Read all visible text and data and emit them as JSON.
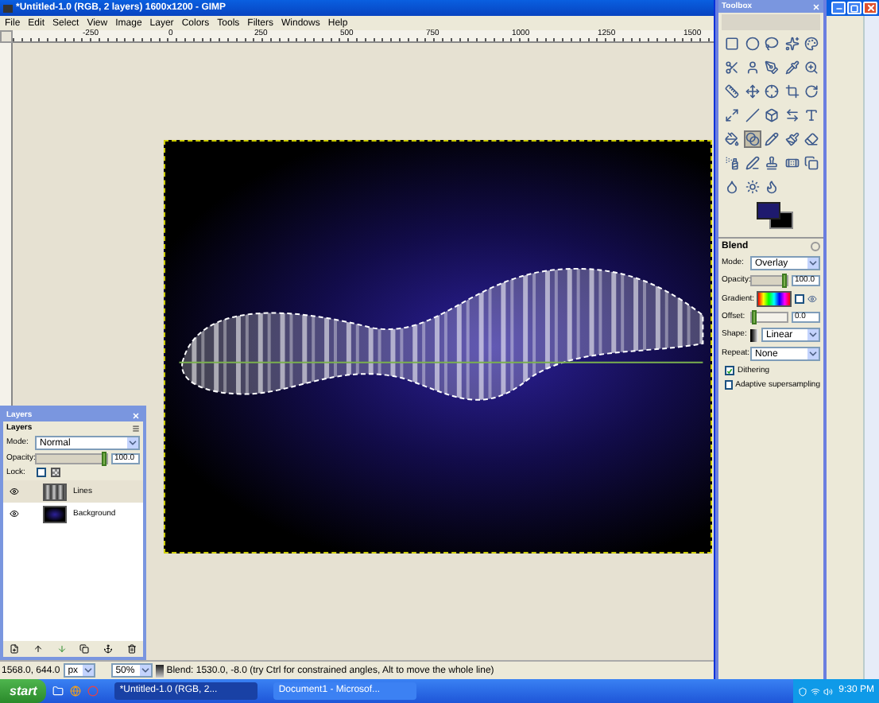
{
  "window": {
    "title": "*Untitled-1.0 (RGB, 2 layers) 1600x1200 - GIMP"
  },
  "menu": [
    "File",
    "Edit",
    "Select",
    "View",
    "Image",
    "Layer",
    "Colors",
    "Tools",
    "Filters",
    "Windows",
    "Help"
  ],
  "ruler": [
    "-250",
    "0",
    "250",
    "500",
    "750",
    "1000",
    "1250",
    "1500"
  ],
  "status_bar": {
    "coordinates": "1568.0, 644.0",
    "unit": "px",
    "zoom": "50%",
    "message": "Blend: 1530.0, -8.0 (try Ctrl for constrained angles, Alt to move the whole line)"
  },
  "layers_dialog": {
    "title": "Layers",
    "tab": "Layers",
    "mode_label": "Mode:",
    "mode": "Normal",
    "opacity_label": "Opacity:",
    "opacity": {
      "level": 1,
      "reading": "100.0"
    },
    "lock_label": "Lock:",
    "layers": [
      {
        "name": "Lines",
        "visible": true,
        "selected": true
      },
      {
        "name": "Background",
        "visible": true,
        "selected": false
      }
    ]
  },
  "toolbox": {
    "title": "Toolbox",
    "tools": [
      {
        "selected": false
      },
      {
        "selected": false
      },
      {
        "selected": false
      },
      {
        "selected": false
      },
      {
        "selected": false
      },
      {
        "selected": false
      },
      {
        "selected": false
      },
      {
        "selected": false
      },
      {
        "selected": false
      },
      {
        "selected": false
      },
      {
        "selected": false
      },
      {
        "selected": false
      },
      {
        "selected": false
      },
      {
        "selected": false
      },
      {
        "selected": false
      },
      {
        "selected": false
      },
      {
        "selected": false
      },
      {
        "selected": false
      },
      {
        "selected": false
      },
      {
        "selected": false
      },
      {
        "selected": false
      },
      {
        "selected": true
      },
      {
        "selected": false
      },
      {
        "selected": false
      },
      {
        "selected": false
      },
      {
        "selected": false
      },
      {
        "selected": false
      },
      {
        "selected": false
      },
      {
        "selected": false
      },
      {
        "selected": false
      },
      {
        "selected": false
      },
      {
        "selected": false
      },
      {
        "selected": false
      }
    ],
    "options": {
      "title": "Blend",
      "mode_label": "Mode:",
      "mode": "Overlay",
      "opacity_label": "Opacity:",
      "opacity": {
        "level": 1,
        "reading": "100.0"
      },
      "gradient_label": "Gradient:",
      "reverse": false,
      "offset_label": "Offset:",
      "offset": {
        "level": 0,
        "reading": "0.0"
      },
      "shape_label": "Shape:",
      "shape": "Linear",
      "repeat_label": "Repeat:",
      "repeat": "None",
      "checkboxes": [
        {
          "label": "Dithering",
          "checked": true
        },
        {
          "label": "Adaptive supersampling",
          "checked": false
        }
      ]
    }
  },
  "taskbar": {
    "start": "start",
    "tasks": [
      {
        "label": "*Untitled-1.0 (RGB, 2...",
        "selected": true
      },
      {
        "label": "Document1 - Microsof...",
        "selected": false
      }
    ],
    "clock": "9:30 PM"
  }
}
